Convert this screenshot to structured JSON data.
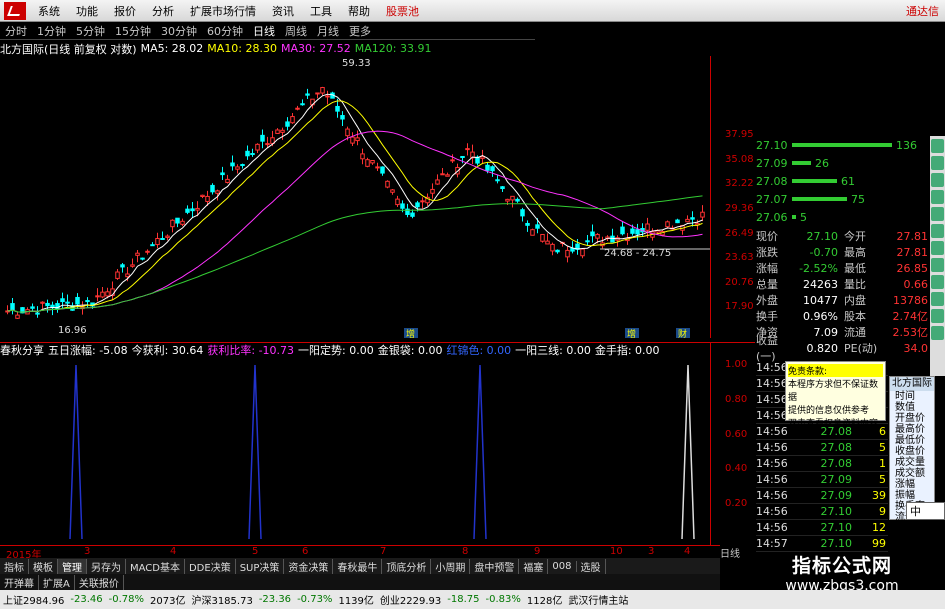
{
  "menu": {
    "items": [
      "系统",
      "功能",
      "报价",
      "分析",
      "扩展市场行情",
      "资讯",
      "工具",
      "帮助"
    ],
    "highlight": "股票池",
    "right_label": "通达信"
  },
  "periods": [
    "分时",
    "1分钟",
    "5分钟",
    "15分钟",
    "30分钟",
    "60分钟",
    "日线",
    "周线",
    "月线",
    "更多"
  ],
  "selected_period": "日线",
  "main_header": {
    "name": "北方国际(日线 前复权 对数)",
    "ma5": "MA5: 28.02",
    "ma10": "MA10: 28.30",
    "ma30": "MA30: 27.52",
    "ma120": "MA120: 33.91"
  },
  "chart_data": [
    {
      "type": "line",
      "title": "北方国际(日线 前复权 对数)",
      "ylim": [
        15.5,
        46.0
      ],
      "yticks": [
        "37.95",
        "35.08",
        "32.22",
        "29.36",
        "26.49",
        "23.63",
        "20.76",
        "17.90"
      ],
      "annotations": [
        "59.33",
        "16.96",
        "24.68 - 24.75"
      ],
      "markers": [
        "增",
        "增",
        "财"
      ],
      "series": [
        {
          "name": "MA5",
          "color": "#ffffff"
        },
        {
          "name": "MA10",
          "color": "#ffff00"
        },
        {
          "name": "MA30",
          "color": "#ff33ff"
        },
        {
          "name": "MA120",
          "color": "#33cc33"
        }
      ]
    },
    {
      "type": "bar",
      "title": "春秋分享",
      "ylim": [
        0,
        1.0
      ],
      "yticks": [
        "1.00",
        "0.80",
        "0.60",
        "0.40",
        "0.20"
      ]
    }
  ],
  "sub_header": {
    "name": "春秋分享",
    "p1": "五日涨幅: -5.08",
    "p2": "今获利: 30.64",
    "p3": "获利比率: -10.73",
    "p4": "一阳定势: 0.00",
    "p5": "金银袋: 0.00",
    "p6": "红锦色: 0.00",
    "p7": "一阳三线: 0.00",
    "p8": "金手指: 0.00"
  },
  "date_axis": [
    "2015年",
    "3",
    "4",
    "5",
    "6",
    "7",
    "8",
    "9",
    "10",
    "3",
    "4"
  ],
  "date_axis_right": "日线",
  "tabs_row1": [
    "指标",
    "模板",
    "管理",
    "另存为",
    "MACD基本",
    "DDE决策",
    "SUP决策",
    "资金决策",
    "春秋最牛",
    "顶底分析",
    "小周期",
    "盘中预警",
    "福塞",
    "008",
    "选股"
  ],
  "tabs_row2": [
    "开弹幕",
    "扩展A",
    "关联报价"
  ],
  "sell_orders": [
    {
      "price": "27.10",
      "qty": "136"
    },
    {
      "price": "27.09",
      "qty": "26"
    },
    {
      "price": "27.08",
      "qty": "61"
    },
    {
      "price": "27.07",
      "qty": "75"
    },
    {
      "price": "27.06",
      "qty": "5"
    }
  ],
  "quote": [
    {
      "l": "现价",
      "v": "27.10",
      "l2": "今开",
      "v2": "27.81"
    },
    {
      "l": "涨跌",
      "v": "-0.70",
      "l2": "最高",
      "v2": "27.81"
    },
    {
      "l": "涨幅",
      "v": "-2.52%",
      "l2": "最低",
      "v2": "26.85"
    },
    {
      "l": "总量",
      "v": "24263",
      "l2": "量比",
      "v2": "0.66"
    },
    {
      "l": "外盘",
      "v": "10477",
      "l2": "内盘",
      "v2": "13786"
    },
    {
      "l": "换手",
      "v": "0.96%",
      "l2": "股本",
      "v2": "2.74亿"
    },
    {
      "l": "净资",
      "v": "7.09",
      "l2": "流通",
      "v2": "2.53亿"
    },
    {
      "l": "收益(一)",
      "v": "0.820",
      "l2": "PE(动)",
      "v2": "34.0"
    }
  ],
  "ticks": [
    {
      "t": "14:56",
      "p": "",
      "v": ""
    },
    {
      "t": "14:56",
      "p": "",
      "v": ""
    },
    {
      "t": "14:56",
      "p": "",
      "v": ""
    },
    {
      "t": "14:56",
      "p": "",
      "v": ""
    },
    {
      "t": "14:56",
      "p": "27.08",
      "v": "6"
    },
    {
      "t": "14:56",
      "p": "27.08",
      "v": "5"
    },
    {
      "t": "14:56",
      "p": "27.08",
      "v": "1"
    },
    {
      "t": "14:56",
      "p": "27.09",
      "v": "5"
    },
    {
      "t": "14:56",
      "p": "27.09",
      "v": "39"
    },
    {
      "t": "14:56",
      "p": "27.10",
      "v": "9"
    },
    {
      "t": "14:56",
      "p": "27.10",
      "v": "12"
    },
    {
      "t": "14:57",
      "p": "27.10",
      "v": "99"
    }
  ],
  "disclaimer": {
    "title": "免责条款:",
    "lines": [
      "本程序方求但不保证数据",
      "提供的信息仅供参考",
      "双击查看权息资料内容"
    ]
  },
  "right_panel": {
    "title": "北方国际",
    "items": [
      "时间",
      "数值",
      "开盘价",
      "最高价",
      "最低价",
      "收盘价",
      "成交量",
      "成交额",
      "涨幅",
      "振幅",
      "换手率",
      "流通股"
    ]
  },
  "ime": "中",
  "watermark": {
    "line1": "指标公式网",
    "line2": "www.zbgs3.com"
  },
  "status": [
    {
      "text": "上证2984.96",
      "c": "white"
    },
    {
      "text": "-23.46",
      "c": "green"
    },
    {
      "text": "-0.78%",
      "c": "green"
    },
    {
      "text": "2073亿",
      "c": "white"
    },
    {
      "text": "沪深3185.73",
      "c": "white"
    },
    {
      "text": "-23.36",
      "c": "green"
    },
    {
      "text": "-0.73%",
      "c": "green"
    },
    {
      "text": "1139亿",
      "c": "white"
    },
    {
      "text": "创业2229.93",
      "c": "white"
    },
    {
      "text": "-18.75",
      "c": "green"
    },
    {
      "text": "-0.83%",
      "c": "green"
    },
    {
      "text": "1128亿",
      "c": "white"
    },
    {
      "text": "武汉行情主站",
      "c": "white"
    }
  ]
}
